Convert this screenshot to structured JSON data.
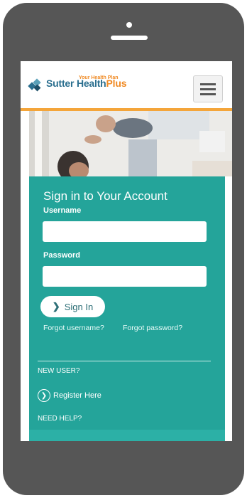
{
  "brand": {
    "name_main": "Sutter Health",
    "name_accent": "Plus",
    "tagline": "Your Health Plan"
  },
  "icons": {
    "logo": "sutter-logo-icon",
    "menu": "hamburger-menu-icon",
    "chevron": "chevron-right-icon",
    "register": "circle-chevron-icon"
  },
  "colors": {
    "frame": "#565656",
    "panel": "#24a49a",
    "header_border": "#f4a53a",
    "brand_blue": "#2b6f8f",
    "brand_orange": "#f08a24"
  },
  "signin": {
    "title": "Sign in to Your Account",
    "username_label": "Username",
    "username_value": "",
    "password_label": "Password",
    "password_value": "",
    "button_label": "Sign In",
    "forgot_username": "Forgot username?",
    "forgot_password": "Forgot password?"
  },
  "new_user": {
    "heading": "NEW USER?",
    "register_label": "Register Here"
  },
  "help": {
    "heading": "NEED HELP?"
  }
}
